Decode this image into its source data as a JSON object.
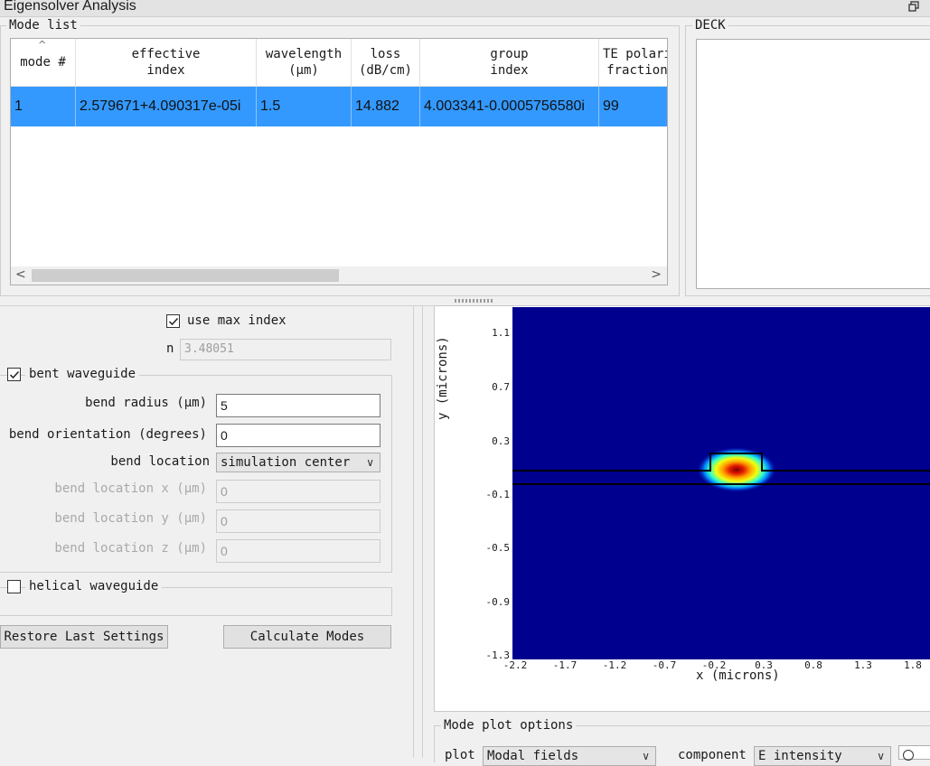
{
  "window": {
    "title": "Eigensolver Analysis",
    "restore_icon": "restore-window-icon"
  },
  "mode_list": {
    "legend": "Mode list",
    "columns": [
      {
        "label": "mode #"
      },
      {
        "label": "effective\nindex"
      },
      {
        "label": "wavelength\n(μm)"
      },
      {
        "label": "loss\n(dB/cm)"
      },
      {
        "label": "group\nindex"
      },
      {
        "label": "TE polari\nfraction"
      }
    ],
    "rows": [
      {
        "mode": "1",
        "effective_index": "2.579671+4.090317e-05i",
        "wavelength": "1.5",
        "loss": "14.882",
        "group_index": "4.003341-0.0005756580i",
        "te_fraction": "99"
      }
    ],
    "selected_row": 0,
    "scroll_left": "<",
    "scroll_right": ">"
  },
  "deck": {
    "legend": "DECK"
  },
  "settings": {
    "use_max_index": {
      "label": "use max index",
      "checked": true
    },
    "n": {
      "label": "n",
      "value": "3.48051"
    },
    "bent_waveguide": {
      "label": "bent waveguide",
      "checked": true
    },
    "bend_radius": {
      "label": "bend radius (μm)",
      "value": "5"
    },
    "bend_orientation": {
      "label": "bend orientation (degrees)",
      "value": "0"
    },
    "bend_location": {
      "label": "bend location",
      "value": "simulation center"
    },
    "bend_location_x": {
      "label": "bend location x (μm)",
      "value": "0"
    },
    "bend_location_y": {
      "label": "bend location y (μm)",
      "value": "0"
    },
    "bend_location_z": {
      "label": "bend location z (μm)",
      "value": "0"
    },
    "helical_waveguide": {
      "label": "helical waveguide",
      "checked": false
    },
    "restore_button": "Restore Last Settings",
    "calculate_button": "Calculate Modes"
  },
  "plot": {
    "ylabel": "y (microns)",
    "xlabel": "x (microns)",
    "yticks": [
      "1.1",
      "0.7",
      "0.3",
      "-0.1",
      "-0.5",
      "-0.9",
      "-1.3"
    ],
    "xticks": [
      "-2.2",
      "-1.7",
      "-1.2",
      "-0.7",
      "-0.2",
      "0.3",
      "0.8",
      "1.3",
      "1.8"
    ],
    "colors": {
      "background": "#00008f",
      "outline": "#000000"
    }
  },
  "plot_options": {
    "legend": "Mode plot options",
    "plot_label": "plot",
    "plot_value": "Modal fields",
    "component_label": "component",
    "component_value": "E intensity"
  }
}
